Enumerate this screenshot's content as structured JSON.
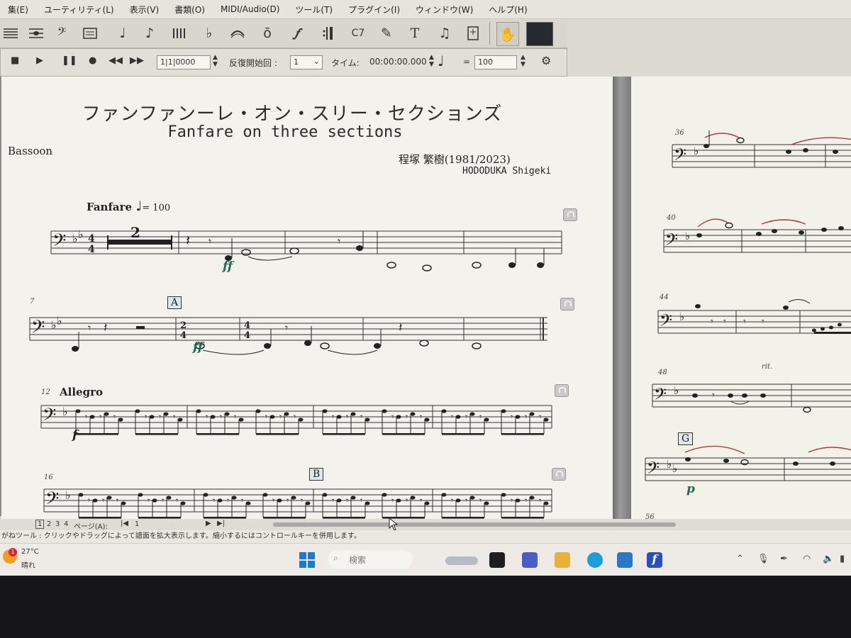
{
  "menu": {
    "items": [
      "集(E)",
      "ユーティリティ(L)",
      "表示(V)",
      "書類(O)",
      "MIDI/Audio(D)",
      "ツール(T)",
      "プラグイン(I)",
      "ウィンドウ(W)",
      "ヘルプ(H)"
    ]
  },
  "toolbar": {
    "icons": [
      "staff-tool",
      "simple-entry-tool",
      "clef-tool",
      "key-signature-tool",
      "time-signature-tool",
      "speedy-entry-tool",
      "tuplet-tool",
      "smart-shape-tool",
      "articulation-tool",
      "expression-tool",
      "repeat-tool",
      "chord-tool",
      "lyrics-tool",
      "text-tool",
      "measure-tool",
      "page-layout-tool",
      "hand-grabber-tool",
      "zoom-tool"
    ]
  },
  "playback": {
    "position": "1|1|0000",
    "repeat_label": "反復開始回 :",
    "repeat_value": "1",
    "time_label": "タイム:",
    "time_value": "00:00:00.000",
    "tempo_equals": "=",
    "tempo_value": "100"
  },
  "score": {
    "title": "ファンファンーレ・オン・スリー・セクションズ",
    "subtitle": "Fanfare on three sections",
    "composer_jp": "程塚 繁樹(1981/2023)",
    "composer_en": "HODODUKA Shigeki",
    "instrument": "Bassoon",
    "tempo_fanfare": "Fanfare",
    "tempo_fanfare_mm": "= 100",
    "tempo_allegro": "Allegro",
    "rehearsal_a": "A",
    "rehearsal_b": "B",
    "rehearsal_g": "G",
    "dyn_ff": "ff",
    "dyn_f": "f",
    "dyn_p": "p",
    "multirest": "2",
    "rit": "rit.",
    "measure_numbers": {
      "m7": "7",
      "m12": "12",
      "m16": "16",
      "m36": "36",
      "m40": "40",
      "m44": "44",
      "m48": "48",
      "m56": "56"
    }
  },
  "pagenav": {
    "pages": [
      "1",
      "2",
      "3",
      "4"
    ],
    "page_label": "ページ(A):",
    "page_value": "1"
  },
  "status": {
    "hint": "がねツール : クリックやドラッグによって譜面を拡大表示します。縮小するにはコントロールキーを併用します。"
  },
  "taskbar": {
    "weather_temp": "27°C",
    "weather_desc": "晴れ",
    "weather_badge": "1",
    "search_placeholder": "検索"
  },
  "colors": {
    "accent_dynamics": "#1f6a55",
    "slur_red": "#b23a3a"
  }
}
